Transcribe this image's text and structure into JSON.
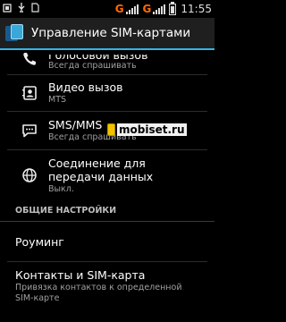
{
  "status_bar": {
    "network_1": "G",
    "network_2": "G",
    "time": "11:55",
    "battery_level": 0.7,
    "icons": [
      "notification-icon",
      "usb-icon",
      "storage-icon"
    ]
  },
  "action_bar": {
    "title": "Управление SIM-картами",
    "accent_color": "#33b5e5"
  },
  "items": [
    {
      "title": "Голосовой вызов",
      "subtitle": "Всегда спрашивать",
      "icon": "phone-icon"
    },
    {
      "title": "Видео вызов",
      "subtitle": "MTS",
      "icon": "video-contact-icon"
    },
    {
      "title": "SMS/MMS",
      "subtitle": "Всегда спрашивать",
      "icon": "message-icon"
    },
    {
      "title": "Соединение для передачи данных",
      "subtitle": "Выкл.",
      "icon": "globe-icon"
    }
  ],
  "section": {
    "label": "ОБЩИЕ НАСТРОЙКИ"
  },
  "general_items": [
    {
      "title": "Роуминг"
    },
    {
      "title": "Контакты и SIM-карта",
      "subtitle": "Привязка контактов к определенной SIM-карте"
    }
  ],
  "watermark": {
    "text": "mobiset.ru"
  }
}
